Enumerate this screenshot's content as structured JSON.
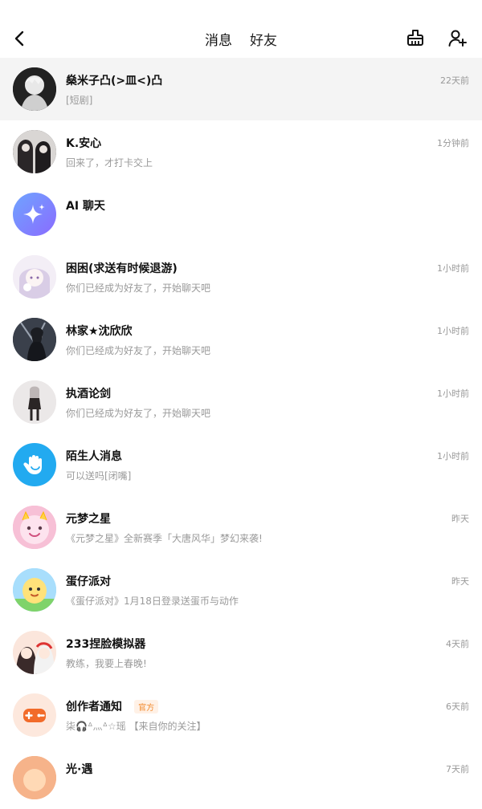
{
  "header": {
    "tabs": [
      {
        "label": "消息",
        "active": true
      },
      {
        "label": "好友",
        "active": false
      }
    ],
    "accent": "#f5772a"
  },
  "conversations": [
    {
      "name": "燊米子凸(>皿<)凸",
      "preview": "[短剧]",
      "time": "22天前",
      "highlight": true
    },
    {
      "name": "K.安心",
      "preview": "回来了，才打卡交上",
      "time": "1分钟前"
    },
    {
      "name": "AI 聊天",
      "preview": "",
      "time": ""
    },
    {
      "name": "困困(求送有时候退游)",
      "preview": "你们已经成为好友了，开始聊天吧",
      "time": "1小时前"
    },
    {
      "name": "林家★沈欣欣",
      "preview": "你们已经成为好友了，开始聊天吧",
      "time": "1小时前"
    },
    {
      "name": "执酒论剑",
      "preview": "你们已经成为好友了，开始聊天吧",
      "time": "1小时前"
    },
    {
      "name": "陌生人消息",
      "preview": "可以送吗[闭嘴]",
      "time": "1小时前"
    },
    {
      "name": "元梦之星",
      "preview": "《元梦之星》全新赛季「大唐风华」梦幻来袭!",
      "time": "昨天"
    },
    {
      "name": "蛋仔派对",
      "preview": "《蛋仔派对》1月18日登录送蛋币与动作",
      "time": "昨天"
    },
    {
      "name": "233捏脸模拟器",
      "preview": "教练，我要上春晚!",
      "time": "4天前"
    },
    {
      "name": "创作者通知",
      "badge": "官方",
      "preview": "柒🎧ᐞ灬ᐞ☆瑶 【来自你的关注】",
      "time": "6天前"
    },
    {
      "name": "光·遇",
      "preview": "",
      "time": "7天前"
    }
  ]
}
